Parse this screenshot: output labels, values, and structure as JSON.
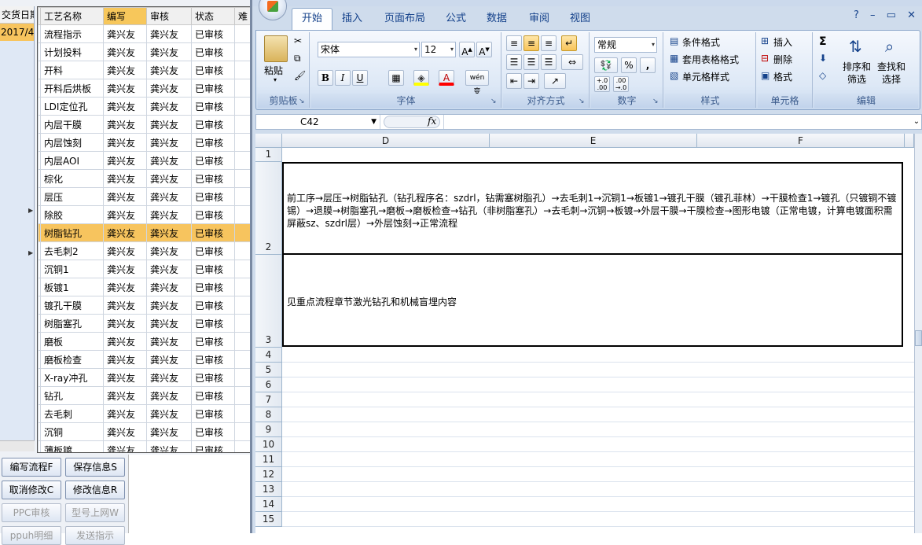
{
  "left_app": {
    "strip_header": "交货日期",
    "strip_cell": "2017/4/",
    "grid_headers": [
      "工艺名称",
      "编写",
      "审核",
      "状态",
      "难"
    ],
    "rows": [
      [
        "流程指示",
        "龚兴友",
        "龚兴友",
        "已审核"
      ],
      [
        "计划投料",
        "龚兴友",
        "龚兴友",
        "已审核"
      ],
      [
        "开料",
        "龚兴友",
        "龚兴友",
        "已审核"
      ],
      [
        "开料后烘板",
        "龚兴友",
        "龚兴友",
        "已审核"
      ],
      [
        "LDI定位孔",
        "龚兴友",
        "龚兴友",
        "已审核"
      ],
      [
        "内层干膜",
        "龚兴友",
        "龚兴友",
        "已审核"
      ],
      [
        "内层蚀刻",
        "龚兴友",
        "龚兴友",
        "已审核"
      ],
      [
        "内层AOI",
        "龚兴友",
        "龚兴友",
        "已审核"
      ],
      [
        "棕化",
        "龚兴友",
        "龚兴友",
        "已审核"
      ],
      [
        "层压",
        "龚兴友",
        "龚兴友",
        "已审核"
      ],
      [
        "除胶",
        "龚兴友",
        "龚兴友",
        "已审核"
      ],
      [
        "树脂钻孔",
        "龚兴友",
        "龚兴友",
        "已审核"
      ],
      [
        "去毛刺2",
        "龚兴友",
        "龚兴友",
        "已审核"
      ],
      [
        "沉铜1",
        "龚兴友",
        "龚兴友",
        "已审核"
      ],
      [
        "板镀1",
        "龚兴友",
        "龚兴友",
        "已审核"
      ],
      [
        "镀孔干膜",
        "龚兴友",
        "龚兴友",
        "已审核"
      ],
      [
        "树脂塞孔",
        "龚兴友",
        "龚兴友",
        "已审核"
      ],
      [
        "磨板",
        "龚兴友",
        "龚兴友",
        "已审核"
      ],
      [
        "磨板检查",
        "龚兴友",
        "龚兴友",
        "已审核"
      ],
      [
        "X-ray冲孔",
        "龚兴友",
        "龚兴友",
        "已审核"
      ],
      [
        "钻孔",
        "龚兴友",
        "龚兴友",
        "已审核"
      ],
      [
        "去毛刺",
        "龚兴友",
        "龚兴友",
        "已审核"
      ],
      [
        "沉铜",
        "龚兴友",
        "龚兴友",
        "已审核"
      ],
      [
        "薄板镀",
        "龚兴友",
        "龚兴友",
        "已审核"
      ]
    ],
    "selected_row_index": 11,
    "buttons": {
      "write_flow": "编写流程F",
      "save_info": "保存信息S",
      "cancel_edit": "取消修改C",
      "edit_info": "修改信息R",
      "ppc_review": "PPC审核",
      "model_online": "型号上网W",
      "partial_1": "ppuh明细",
      "partial_2": "发送指示"
    }
  },
  "excel": {
    "tabs": [
      "开始",
      "插入",
      "页面布局",
      "公式",
      "数据",
      "审阅",
      "视图"
    ],
    "active_tab": "开始",
    "clipboard": {
      "paste": "粘贴",
      "label": "剪贴板"
    },
    "font": {
      "name": "宋体",
      "size": "12",
      "label": "字体",
      "bold": "B",
      "italic": "I",
      "underline": "U",
      "color_letter": "A",
      "wen": "wén 变"
    },
    "alignment": {
      "label": "对齐方式"
    },
    "number": {
      "format": "常规",
      "label": "数字",
      "percent": "%",
      "comma": ",",
      "inc": "+.0 .00",
      "dec": ".00 →.0"
    },
    "styles": {
      "conditional": "条件格式",
      "table": "套用表格格式",
      "cell_styles": "单元格样式",
      "label": "样式"
    },
    "cells": {
      "insert": "插入",
      "delete": "删除",
      "format": "格式",
      "label": "单元格"
    },
    "editing": {
      "sigma": "Σ",
      "sort": "排序和\n筛选",
      "find": "查找和\n选择",
      "label": "编辑"
    },
    "name_box": "C42",
    "fx": "fx",
    "columns": [
      "D",
      "E",
      "F"
    ],
    "rows": [
      "1",
      "2",
      "3",
      "4",
      "5",
      "6",
      "7",
      "8",
      "9",
      "10",
      "11",
      "12",
      "13",
      "14",
      "15"
    ],
    "cell_row2": "前工序→层压→树脂钻孔（钻孔程序名：szdrl，钻需塞树脂孔）→去毛刺1→沉铜1→板镀1→镀孔干膜（镀孔菲林）→干膜检查1→镀孔（只镀铜不镀锡）→退膜→树脂塞孔→磨板→磨板检查→钻孔（非树脂塞孔）→去毛刺→沉铜→板镀→外层干膜→干膜检查→图形电镀（正常电镀，计算电镀面积需屏蔽sz、szdrl层）→外层蚀刻→正常流程",
    "cell_row3": "见重点流程章节激光钻孔和机械盲埋内容"
  },
  "colors": {
    "selection": "#f7c45e",
    "ribbon_text": "#15428b",
    "ribbon_bg": "#dde8f6"
  }
}
